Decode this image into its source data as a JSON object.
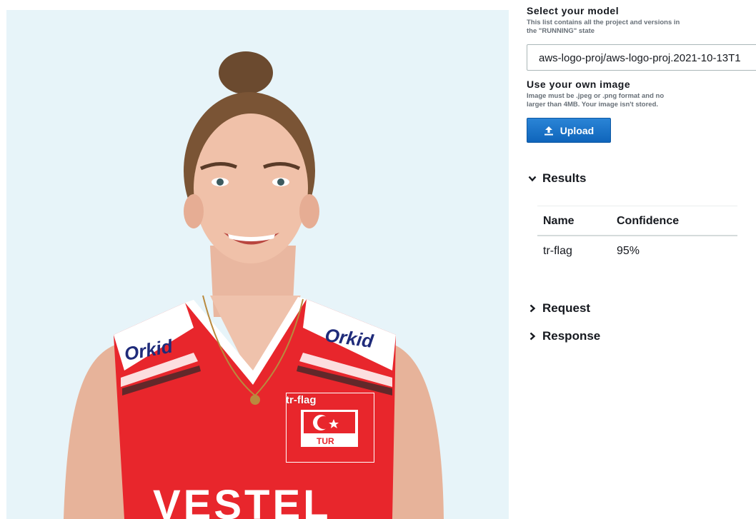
{
  "image": {
    "detection": {
      "label": "tr-flag"
    },
    "jersey": {
      "sponsor_left": "Orkid",
      "sponsor_right": "Orkid",
      "flag_text": "TUR",
      "front_text": "VESTEL"
    }
  },
  "model": {
    "title": "Select your model",
    "help": "This list contains all the project and versions in the \"RUNNING\" state",
    "selected": "aws-logo-proj/aws-logo-proj.2021-10-13T1"
  },
  "upload": {
    "title": "Use your own image",
    "help": "Image must be .jpeg or .png format and no larger than 4MB. Your image isn't stored.",
    "button_label": "Upload"
  },
  "results": {
    "title": "Results",
    "expanded": true,
    "columns": [
      "Name",
      "Confidence"
    ],
    "rows": [
      {
        "name": "tr-flag",
        "confidence": "95%"
      }
    ]
  },
  "request": {
    "title": "Request",
    "expanded": false
  },
  "response": {
    "title": "Response",
    "expanded": false
  },
  "colors": {
    "primary_button": "#1672c9",
    "image_background": "#e7f4f9",
    "jersey_red": "#e8262c"
  },
  "icons": {
    "upload": "upload-icon",
    "expanded": "chevron-down-icon",
    "collapsed": "chevron-right-icon"
  }
}
